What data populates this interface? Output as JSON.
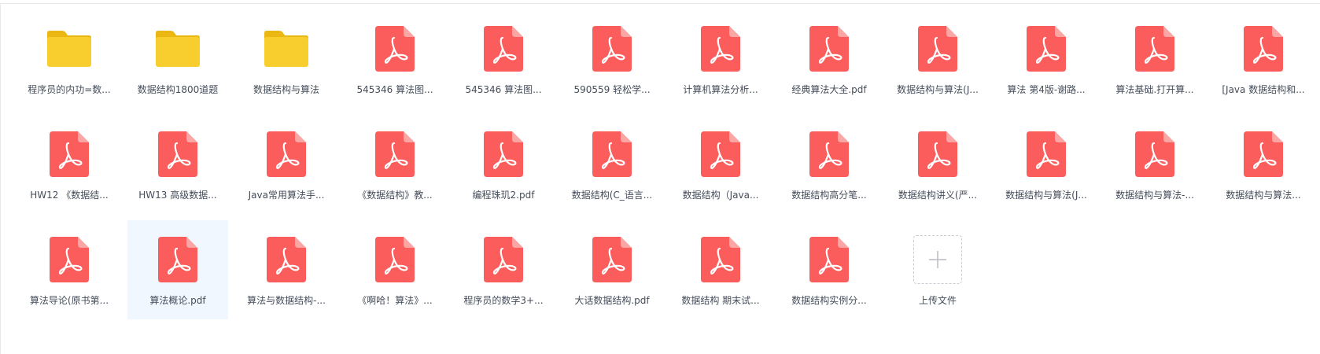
{
  "colors": {
    "folder": "#f8cd2e",
    "folder_tab": "#eab713",
    "pdf": "#fb5d5c",
    "pdf_fold": "#f9a6a4",
    "selected_bg": "#f1f7ff",
    "text": "#454d5a"
  },
  "items": [
    {
      "type": "folder",
      "icon": "folder-icon",
      "name": "程序员的内功=数..."
    },
    {
      "type": "folder",
      "icon": "folder-icon",
      "name": "数据结构1800道题"
    },
    {
      "type": "folder",
      "icon": "folder-icon",
      "name": "数据结构与算法"
    },
    {
      "type": "pdf",
      "icon": "pdf-icon",
      "name": "545346 算法图..."
    },
    {
      "type": "pdf",
      "icon": "pdf-icon",
      "name": "545346 算法图..."
    },
    {
      "type": "pdf",
      "icon": "pdf-icon",
      "name": "590559 轻松学..."
    },
    {
      "type": "pdf",
      "icon": "pdf-icon",
      "name": "计算机算法分析..."
    },
    {
      "type": "pdf",
      "icon": "pdf-icon",
      "name": "经典算法大全.pdf"
    },
    {
      "type": "pdf",
      "icon": "pdf-icon",
      "name": "数据结构与算法(J..."
    },
    {
      "type": "pdf",
      "icon": "pdf-icon",
      "name": "算法 第4版-谢路..."
    },
    {
      "type": "pdf",
      "icon": "pdf-icon",
      "name": "算法基础.打开算..."
    },
    {
      "type": "pdf",
      "icon": "pdf-icon",
      "name": "[Java 数据结构和..."
    },
    {
      "type": "pdf",
      "icon": "pdf-icon",
      "name": "HW12 《数据结..."
    },
    {
      "type": "pdf",
      "icon": "pdf-icon",
      "name": "HW13 高级数据..."
    },
    {
      "type": "pdf",
      "icon": "pdf-icon",
      "name": "Java常用算法手..."
    },
    {
      "type": "pdf",
      "icon": "pdf-icon",
      "name": "《数据结构》教..."
    },
    {
      "type": "pdf",
      "icon": "pdf-icon",
      "name": "编程珠玑2.pdf"
    },
    {
      "type": "pdf",
      "icon": "pdf-icon",
      "name": "数据结构(C_语言..."
    },
    {
      "type": "pdf",
      "icon": "pdf-icon",
      "name": "数据结构（Java..."
    },
    {
      "type": "pdf",
      "icon": "pdf-icon",
      "name": "数据结构高分笔..."
    },
    {
      "type": "pdf",
      "icon": "pdf-icon",
      "name": "数据结构讲义(严..."
    },
    {
      "type": "pdf",
      "icon": "pdf-icon",
      "name": "数据结构与算法(J..."
    },
    {
      "type": "pdf",
      "icon": "pdf-icon",
      "name": "数据结构与算法-..."
    },
    {
      "type": "pdf",
      "icon": "pdf-icon",
      "name": "数据结构与算法..."
    },
    {
      "type": "pdf",
      "icon": "pdf-icon",
      "name": "算法导论(原书第..."
    },
    {
      "type": "pdf",
      "icon": "pdf-icon",
      "name": "算法概论.pdf",
      "selected": true
    },
    {
      "type": "pdf",
      "icon": "pdf-icon",
      "name": "算法与数据结构-..."
    },
    {
      "type": "pdf",
      "icon": "pdf-icon",
      "name": "《啊哈！算法》..."
    },
    {
      "type": "pdf",
      "icon": "pdf-icon",
      "name": "程序员的数学3+..."
    },
    {
      "type": "pdf",
      "icon": "pdf-icon",
      "name": "大话数据结构.pdf"
    },
    {
      "type": "pdf",
      "icon": "pdf-icon",
      "name": "数据结构 期末试..."
    },
    {
      "type": "pdf",
      "icon": "pdf-icon",
      "name": "数据结构实例分..."
    },
    {
      "type": "upload",
      "icon": "plus-icon",
      "name": "上传文件"
    }
  ]
}
